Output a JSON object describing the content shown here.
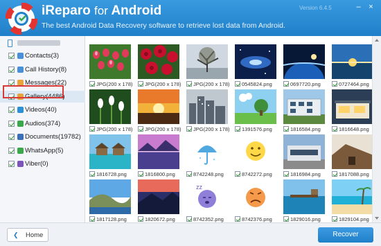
{
  "header": {
    "title_main": "iReparo",
    "title_for": "for",
    "title_platform": "Android",
    "tagline": "The best Android Data Recovery software to retrieve lost data from Android.",
    "version": "Version 6.4.5",
    "minimize_glyph": "–",
    "close_glyph": "×"
  },
  "sidebar": {
    "items": [
      {
        "label": "Contacts(3)",
        "color": "#4a90d9"
      },
      {
        "label": "Call History(8)",
        "color": "#4a90d9"
      },
      {
        "label": "Messages(22)",
        "color": "#e8a33c"
      },
      {
        "label": "Gallery(4486)",
        "color": "#e8a33c"
      },
      {
        "label": "Videos(40)",
        "color": "#2d8fd6"
      },
      {
        "label": "Audios(374)",
        "color": "#3aa84a"
      },
      {
        "label": "Documents(19782)",
        "color": "#3a6fb8"
      },
      {
        "label": "WhatsApp(5)",
        "color": "#3aa84a"
      },
      {
        "label": "Viber(0)",
        "color": "#7b56b8"
      }
    ],
    "selected": "Gallery(4486)"
  },
  "gallery": {
    "items": [
      {
        "name": "JPG(200 x 178)",
        "scene": "tulips"
      },
      {
        "name": "JPG(200 x 178)",
        "scene": "roses"
      },
      {
        "name": "JPG(200 x 178)",
        "scene": "tree"
      },
      {
        "name": "0545824.png",
        "scene": "galaxy"
      },
      {
        "name": "0697720.png",
        "scene": "planet"
      },
      {
        "name": "0727464.png",
        "scene": "ocean"
      },
      {
        "name": "JPG(200 x 178)",
        "scene": "snowdrops"
      },
      {
        "name": "JPG(200 x 178)",
        "scene": "sunset"
      },
      {
        "name": "JPG(200 x 178)",
        "scene": "city"
      },
      {
        "name": "1391576.png",
        "scene": "fantasy"
      },
      {
        "name": "1816584.png",
        "scene": "building"
      },
      {
        "name": "1816648.png",
        "scene": "house"
      },
      {
        "name": "1816728.png",
        "scene": "villa"
      },
      {
        "name": "1816800.png",
        "scene": "lake"
      },
      {
        "name": "8742248.png",
        "scene": "umbrella"
      },
      {
        "name": "8742272.png",
        "scene": "smile"
      },
      {
        "name": "1816984.png",
        "scene": "modern"
      },
      {
        "name": "1817088.png",
        "scene": "roof"
      },
      {
        "name": "1817128.png",
        "scene": "hills"
      },
      {
        "name": "1820672.png",
        "scene": "dusk"
      },
      {
        "name": "8742352.png",
        "scene": "sleepy"
      },
      {
        "name": "8742376.png",
        "scene": "angry"
      },
      {
        "name": "1829016.png",
        "scene": "pier"
      },
      {
        "name": "1829104.png",
        "scene": "beach"
      }
    ]
  },
  "footer": {
    "home_label": "Home",
    "home_arrow": "❮",
    "recover_label": "Recover"
  }
}
